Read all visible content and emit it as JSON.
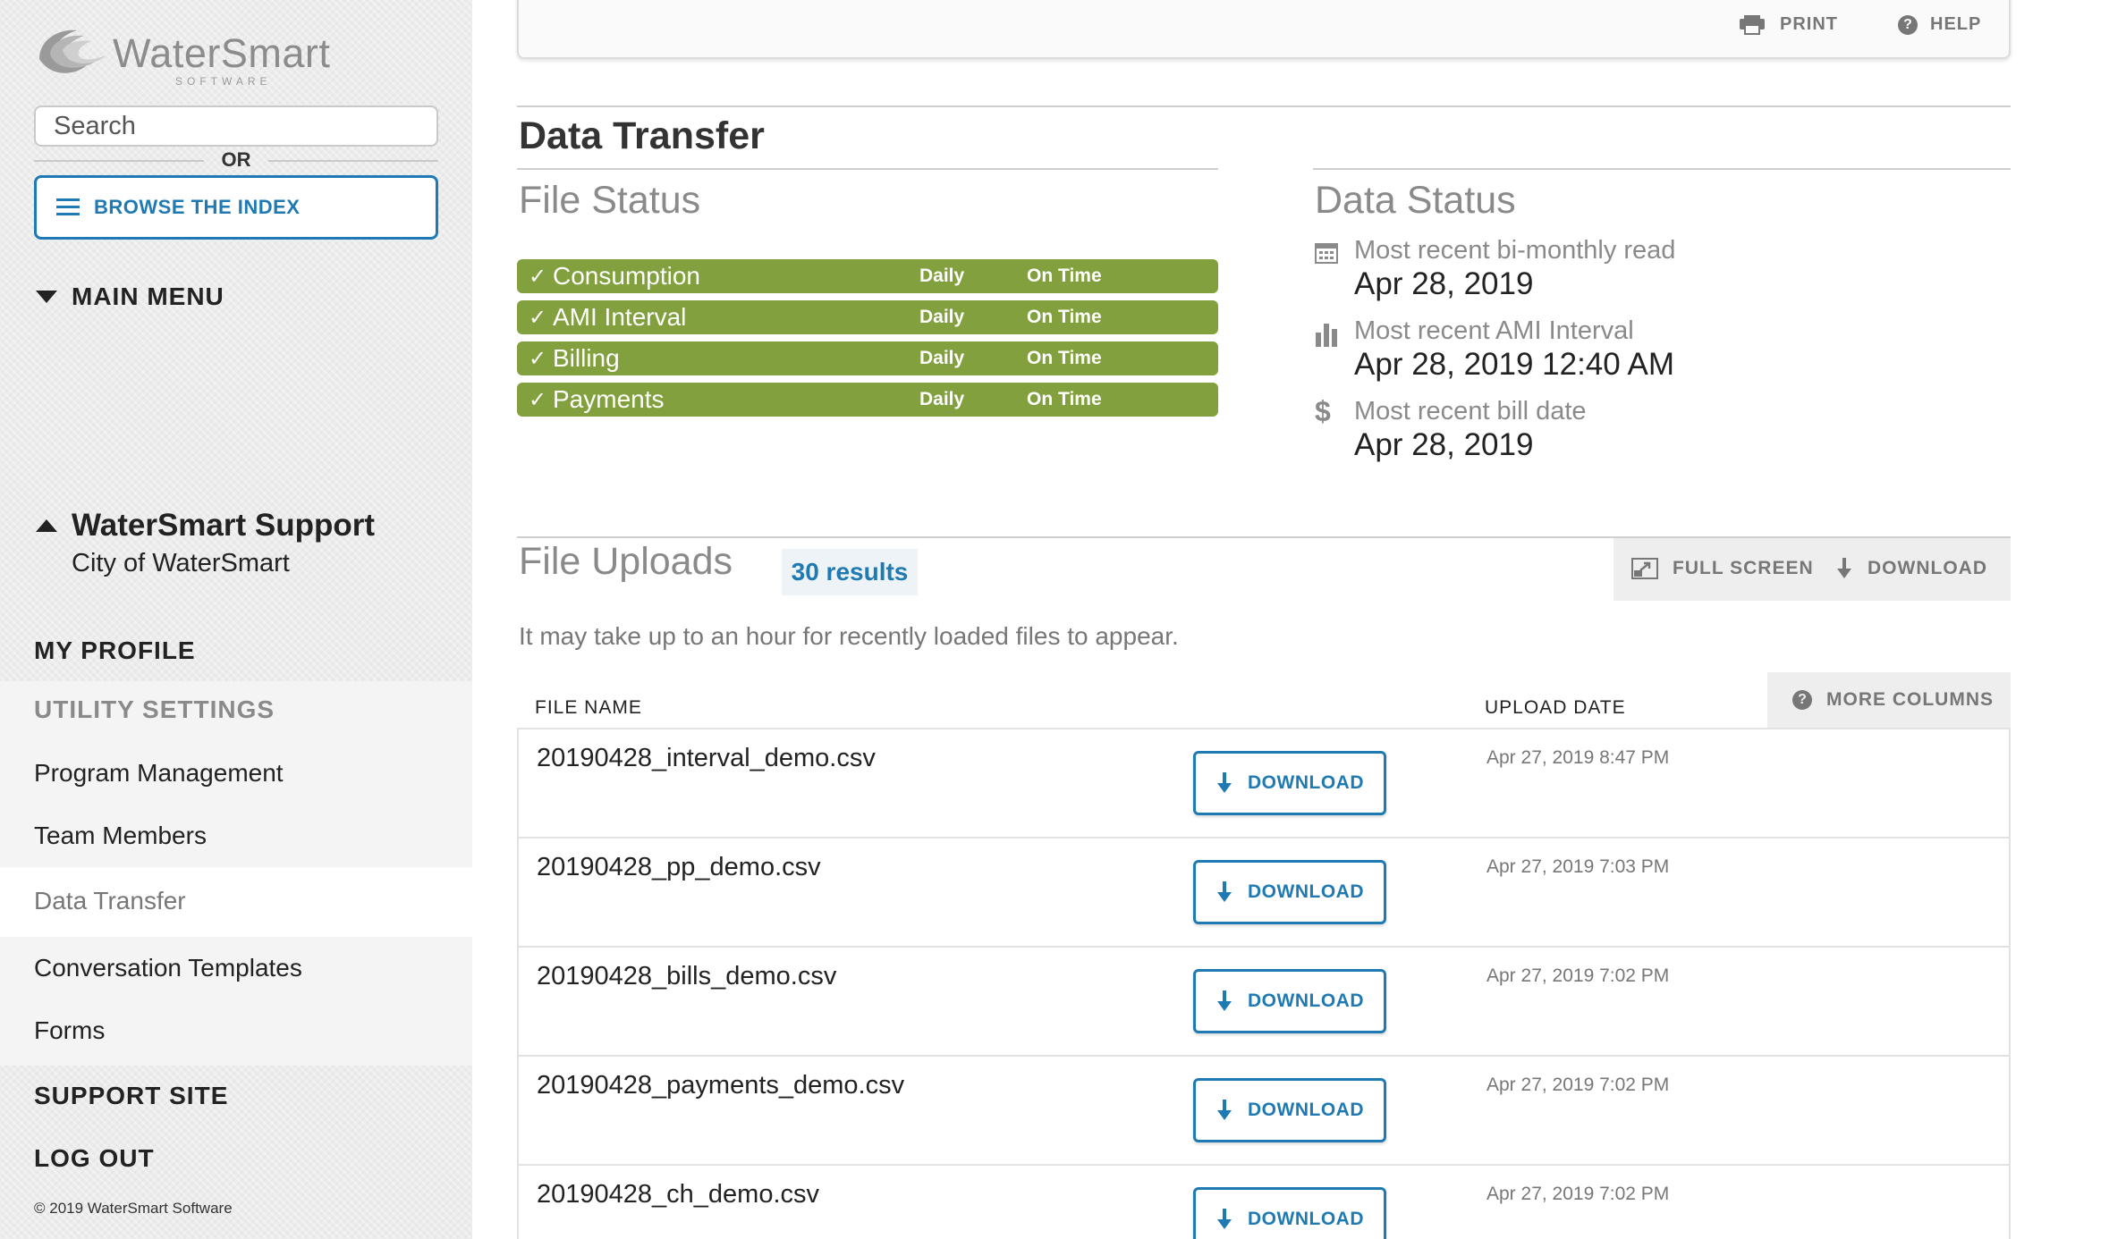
{
  "brand": {
    "name": "WaterSmart",
    "sub": "SOFTWARE"
  },
  "sidebar": {
    "search_placeholder": "Search",
    "or_label": "OR",
    "browse_label": "BROWSE THE INDEX",
    "main_menu_label": "MAIN MENU",
    "support_title": "WaterSmart Support",
    "support_sub": "City of WaterSmart",
    "my_profile": "MY PROFILE",
    "utility_settings": "UTILITY SETTINGS",
    "utility_items": [
      "Program Management",
      "Team Members",
      "Data Transfer",
      "Conversation Templates",
      "Forms"
    ],
    "support_site": "SUPPORT SITE",
    "log_out": "LOG OUT",
    "copyright": "© 2019 WaterSmart Software"
  },
  "topbar": {
    "print_label": "PRINT",
    "help_label": "HELP"
  },
  "page": {
    "title": "Data Transfer"
  },
  "file_status": {
    "heading": "File Status",
    "rows": [
      {
        "name": "Consumption",
        "freq": "Daily",
        "status": "On Time"
      },
      {
        "name": "AMI Interval",
        "freq": "Daily",
        "status": "On Time"
      },
      {
        "name": "Billing",
        "freq": "Daily",
        "status": "On Time"
      },
      {
        "name": "Payments",
        "freq": "Daily",
        "status": "On Time"
      }
    ]
  },
  "data_status": {
    "heading": "Data Status",
    "items": [
      {
        "label": "Most recent bi-monthly read",
        "value": "Apr 28, 2019",
        "icon": "calendar-icon"
      },
      {
        "label": "Most recent AMI Interval",
        "value": "Apr 28, 2019 12:40 AM",
        "icon": "bar-chart-icon"
      },
      {
        "label": "Most recent bill date",
        "value": "Apr 28, 2019",
        "icon": "dollar-icon"
      }
    ]
  },
  "uploads": {
    "heading": "File Uploads",
    "results": "30 results",
    "full_screen_label": "FULL SCREEN",
    "download_label": "DOWNLOAD",
    "note": "It may take up to an hour for recently loaded files to appear.",
    "more_columns_label": "MORE COLUMNS",
    "col_file_name": "FILE NAME",
    "col_upload_date": "UPLOAD DATE",
    "row_download_label": "DOWNLOAD",
    "rows": [
      {
        "file": "20190428_interval_demo.csv",
        "date": "Apr 27, 2019 8:47 PM"
      },
      {
        "file": "20190428_pp_demo.csv",
        "date": "Apr 27, 2019 7:03 PM"
      },
      {
        "file": "20190428_bills_demo.csv",
        "date": "Apr 27, 2019 7:02 PM"
      },
      {
        "file": "20190428_payments_demo.csv",
        "date": "Apr 27, 2019 7:02 PM"
      },
      {
        "file": "20190428_ch_demo.csv",
        "date": "Apr 27, 2019 7:02 PM"
      }
    ]
  },
  "colors": {
    "accent": "#1f7ab3",
    "status_green": "#83a03e",
    "muted": "#8a8a8a"
  }
}
